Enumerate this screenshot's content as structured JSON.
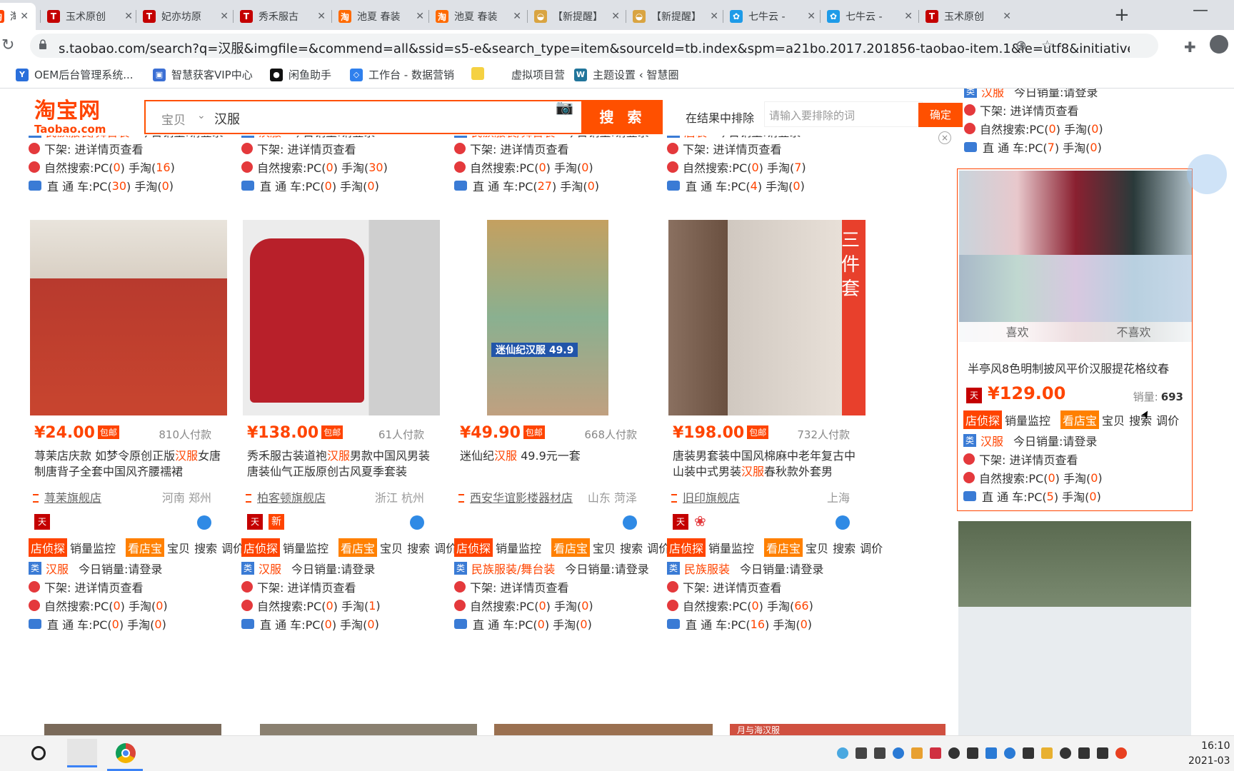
{
  "browser": {
    "tabs": [
      {
        "title": "淘宝",
        "color": "#ff4400",
        "glyph": "淘",
        "active": true
      },
      {
        "title": "玉术原创",
        "color": "#c40000",
        "glyph": "T"
      },
      {
        "title": "妃亦坊原",
        "color": "#c40000",
        "glyph": "T"
      },
      {
        "title": "秀禾服古",
        "color": "#c40000",
        "glyph": "T"
      },
      {
        "title": "池夏 春装",
        "color": "#ff6a00",
        "glyph": "淘"
      },
      {
        "title": "池夏 春装",
        "color": "#ff6a00",
        "glyph": "淘"
      },
      {
        "title": "【新提醒】",
        "color": "#d9a441",
        "glyph": "◒"
      },
      {
        "title": "【新提醒】",
        "color": "#d9a441",
        "glyph": "◒"
      },
      {
        "title": "七牛云 -",
        "color": "#1e9be8",
        "glyph": "✿"
      },
      {
        "title": "七牛云 -",
        "color": "#1e9be8",
        "glyph": "✿"
      },
      {
        "title": "玉术原创",
        "color": "#c40000",
        "glyph": "T"
      }
    ],
    "new_tab": "+",
    "minimize": "—",
    "url": "s.taobao.com/search?q=汉服&imgfile=&commend=all&ssid=s5-e&search_type=item&sourceId=tb.index&spm=a21bo.2017.201856-taobao-item.1&ie=utf8&initiative_id=t...",
    "bookmarks": [
      {
        "label": "OEM后台管理系统...",
        "color": "#2a6fdb",
        "glyph": "Y"
      },
      {
        "label": "智慧获客VIP中心",
        "color": "#3b6fd4",
        "glyph": "▣"
      },
      {
        "label": "闲鱼助手",
        "color": "#111111",
        "glyph": "●"
      },
      {
        "label": "工作台 - 数据营销",
        "color": "#2f80ed",
        "glyph": "◇"
      },
      {
        "label": "",
        "color": "#f5d142",
        "glyph": ""
      },
      {
        "label": "虚拟项目营",
        "color": "#ffffff",
        "glyph": ""
      },
      {
        "label": "主题设置 ‹ 智慧圈",
        "color": "#21759b",
        "glyph": "W"
      }
    ]
  },
  "search": {
    "logo_main": "淘宝网",
    "logo_sub": "Taobao.com",
    "type_label": "宝贝",
    "query": "汉服",
    "button_label": "搜 索",
    "exclude_label": "在结果中排除",
    "exclude_placeholder": "请输入要排除的词",
    "exclude_button": "确定",
    "close": "×"
  },
  "top_row_stats": [
    {
      "cat": "民族服装/舞台装",
      "sales_today": "今日销量:请登录",
      "offshelf": "下架: 进详情页查看",
      "natural": [
        "自然搜索:PC(",
        "0",
        ") 手淘(",
        "16",
        ")"
      ],
      "ztc": [
        "直 通 车:PC(",
        "30",
        ") 手淘(",
        "0",
        ")"
      ]
    },
    {
      "cat": "汉服",
      "sales_today": "今日销量:请登录",
      "offshelf": "下架: 进详情页查看",
      "natural": [
        "自然搜索:PC(",
        "0",
        ") 手淘(",
        "30",
        ")"
      ],
      "ztc": [
        "直 通 车:PC(",
        "0",
        ") 手淘(",
        "0",
        ")"
      ]
    },
    {
      "cat": "民族服装/舞台装",
      "sales_today": "今日销量:请登录",
      "offshelf": "下架: 进详情页查看",
      "natural": [
        "自然搜索:PC(",
        "0",
        ") 手淘(",
        "0",
        ")"
      ],
      "ztc": [
        "直 通 车:PC(",
        "27",
        ") 手淘(",
        "0",
        ")"
      ]
    },
    {
      "cat": "唐装",
      "sales_today": "今日销量:请登录",
      "offshelf": "下架: 进详情页查看",
      "natural": [
        "自然搜索:PC(",
        "0",
        ") 手淘(",
        "7",
        ")"
      ],
      "ztc": [
        "直 通 车:PC(",
        "4",
        ") 手淘(",
        "0",
        ")"
      ]
    }
  ],
  "products": [
    {
      "price": "¥24.00",
      "baoyou": "包邮",
      "paid": "810人付款",
      "title_pre": "荨茉店庆款 如梦令原创正版",
      "title_hl": "汉服",
      "title_post": "女唐制唐背子全套中国风齐腰襦裙",
      "shop": "荨茉旗舰店",
      "location": "河南 郑州",
      "badges": [
        "tmall"
      ],
      "tools": {
        "a": "店侦探",
        "b": "销量监控",
        "c": "看店宝",
        "d": "宝贝",
        "e": "搜索",
        "f": "调价"
      },
      "cat": "汉服",
      "sales_today": "今日销量:请登录",
      "offshelf": "下架: 进详情页查看",
      "natural": [
        "自然搜索:PC(",
        "0",
        ") 手淘(",
        "0",
        ")"
      ],
      "ztc": [
        "直 通 车:PC(",
        "0",
        ") 手淘(",
        "0",
        ")"
      ]
    },
    {
      "price": "¥138.00",
      "baoyou": "包邮",
      "paid": "61人付款",
      "title_pre": "秀禾服古装道袍",
      "title_hl": "汉服",
      "title_post": "男款中国风男装唐装仙气正版原创古风夏季套装",
      "shop": "柏客顿旗舰店",
      "location": "浙江 杭州",
      "badges": [
        "tmall",
        "new"
      ],
      "new_label": "新",
      "tools": {
        "a": "店侦探",
        "b": "销量监控",
        "c": "看店宝",
        "d": "宝贝",
        "e": "搜索",
        "f": "调价"
      },
      "cat": "汉服",
      "sales_today": "今日销量:请登录",
      "offshelf": "下架: 进详情页查看",
      "natural": [
        "自然搜索:PC(",
        "0",
        ") 手淘(",
        "1",
        ")"
      ],
      "ztc": [
        "直 通 车:PC(",
        "0",
        ") 手淘(",
        "0",
        ")"
      ]
    },
    {
      "price": "¥49.90",
      "baoyou": "包邮",
      "paid": "668人付款",
      "title_pre": "迷仙纪",
      "title_hl": "汉服",
      "title_post": " 49.9元一套",
      "shop": "西安华谊影楼器材店",
      "location": "山东 菏泽",
      "badges": [],
      "image_text": "迷仙纪汉服 49.9",
      "tools": {
        "a": "店侦探",
        "b": "销量监控",
        "c": "看店宝",
        "d": "宝贝",
        "e": "搜索",
        "f": "调价"
      },
      "cat": "民族服装/舞台装",
      "sales_today": "今日销量:请登录",
      "offshelf": "下架: 进详情页查看",
      "natural": [
        "自然搜索:PC(",
        "0",
        ") 手淘(",
        "0",
        ")"
      ],
      "ztc": [
        "直 通 车:PC(",
        "0",
        ") 手淘(",
        "0",
        ")"
      ]
    },
    {
      "price": "¥198.00",
      "baoyou": "包邮",
      "paid": "732人付款",
      "title_pre": "唐装男套装中国风棉麻中老年复古中山装中式男装",
      "title_hl": "汉服",
      "title_post": "春秋款外套男",
      "shop": "旧印旗舰店",
      "location": "上海",
      "badges": [
        "tmall",
        "flower"
      ],
      "image_text": "三件套",
      "tools": {
        "a": "店侦探",
        "b": "销量监控",
        "c": "看店宝",
        "d": "宝贝",
        "e": "搜索",
        "f": "调价"
      },
      "cat": "民族服装",
      "sales_today": "今日销量:请登录",
      "offshelf": "下架: 进详情页查看",
      "natural": [
        "自然搜索:PC(",
        "0",
        ") 手淘(",
        "66",
        ")"
      ],
      "ztc": [
        "直 通 车:PC(",
        "16",
        ") 手淘(",
        "0",
        ")"
      ]
    }
  ],
  "right_top": {
    "cat": "汉服",
    "sales_today": "今日销量:请登录",
    "offshelf": "下架: 进详情页查看",
    "natural": [
      "自然搜索:PC(",
      "0",
      ") 手淘(",
      "0",
      ")"
    ],
    "ztc": [
      "直 通 车:PC(",
      "7",
      ") 手淘(",
      "0",
      ")"
    ]
  },
  "featured": {
    "like": "喜欢",
    "dislike": "不喜欢",
    "title": "半亭风8色明制披风平价汉服提花格纹春",
    "price": "¥129.00",
    "sold_label": "销量:",
    "sold": "693",
    "tools": {
      "a": "店侦探",
      "b": "销量监控",
      "c": "看店宝",
      "d": "宝贝",
      "e": "搜索",
      "f": "调价"
    },
    "cat": "汉服",
    "sales_today": "今日销量:请登录",
    "offshelf": "下架: 进详情页查看",
    "natural": [
      "自然搜索:PC(",
      "0",
      ") 手淘(",
      "0",
      ")"
    ],
    "ztc": [
      "直 通 车:PC(",
      "5",
      ") 手淘(",
      "0",
      ")"
    ]
  },
  "bottom_strip_text": "月与海汉服",
  "taskbar": {
    "time": "16:10",
    "date": "2021-03"
  }
}
